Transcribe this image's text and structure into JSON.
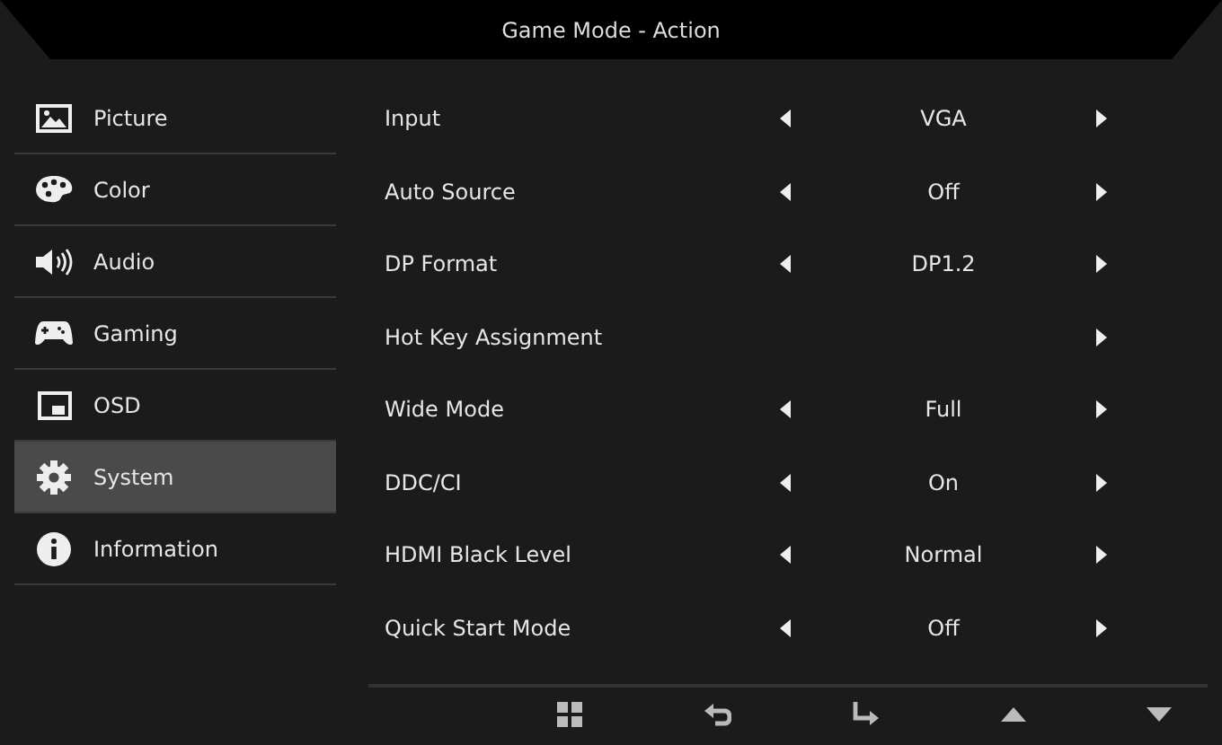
{
  "title": "Game Mode - Action",
  "sidebar": {
    "items": [
      {
        "label": "Picture",
        "selected": false
      },
      {
        "label": "Color",
        "selected": false
      },
      {
        "label": "Audio",
        "selected": false
      },
      {
        "label": "Gaming",
        "selected": false
      },
      {
        "label": "OSD",
        "selected": false
      },
      {
        "label": "System",
        "selected": true
      },
      {
        "label": "Information",
        "selected": false
      }
    ]
  },
  "settings": [
    {
      "kind": "choice",
      "label": "Input",
      "value": "VGA"
    },
    {
      "kind": "choice",
      "label": "Auto Source",
      "value": "Off"
    },
    {
      "kind": "choice",
      "label": "DP Format",
      "value": "DP1.2"
    },
    {
      "kind": "submenu",
      "label": "Hot Key Assignment"
    },
    {
      "kind": "choice",
      "label": "Wide Mode",
      "value": "Full"
    },
    {
      "kind": "choice",
      "label": "DDC/CI",
      "value": "On"
    },
    {
      "kind": "choice",
      "label": "HDMI Black Level",
      "value": "Normal"
    },
    {
      "kind": "choice",
      "label": "Quick Start Mode",
      "value": "Off"
    }
  ]
}
